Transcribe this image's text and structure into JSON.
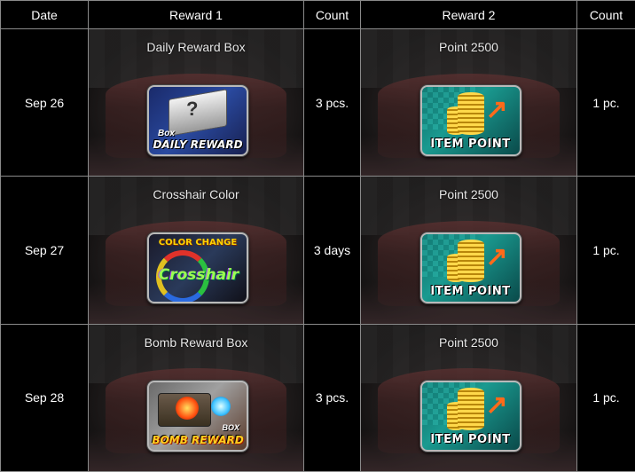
{
  "headers": {
    "date": "Date",
    "reward1": "Reward 1",
    "count1": "Count",
    "reward2": "Reward 2",
    "count2": "Count"
  },
  "rows": [
    {
      "date": "Sep 26",
      "reward1": {
        "name": "Daily Reward Box",
        "icon": "daily-reward-box-icon",
        "icon_sub": "Box",
        "icon_label": "DAILY REWARD"
      },
      "count1": "3 pcs.",
      "reward2": {
        "name": "Point 2500",
        "icon": "item-point-icon",
        "icon_label": "ITEM POINT"
      },
      "count2": "1 pc."
    },
    {
      "date": "Sep 27",
      "reward1": {
        "name": "Crosshair Color",
        "icon": "color-change-crosshair-icon",
        "icon_top": "COLOR CHANGE",
        "icon_label": "Crosshair"
      },
      "count1": "3 days",
      "reward2": {
        "name": "Point 2500",
        "icon": "item-point-icon",
        "icon_label": "ITEM POINT"
      },
      "count2": "1 pc."
    },
    {
      "date": "Sep 28",
      "reward1": {
        "name": "Bomb Reward Box",
        "icon": "bomb-reward-box-icon",
        "icon_sub": "BOX",
        "icon_label": "BOMB REWARD"
      },
      "count1": "3 pcs.",
      "reward2": {
        "name": "Point 2500",
        "icon": "item-point-icon",
        "icon_label": "ITEM POINT"
      },
      "count2": "1 pc."
    }
  ],
  "colors": {
    "background": "#000000",
    "border": "#8a8a8a",
    "text": "#ffffff"
  }
}
